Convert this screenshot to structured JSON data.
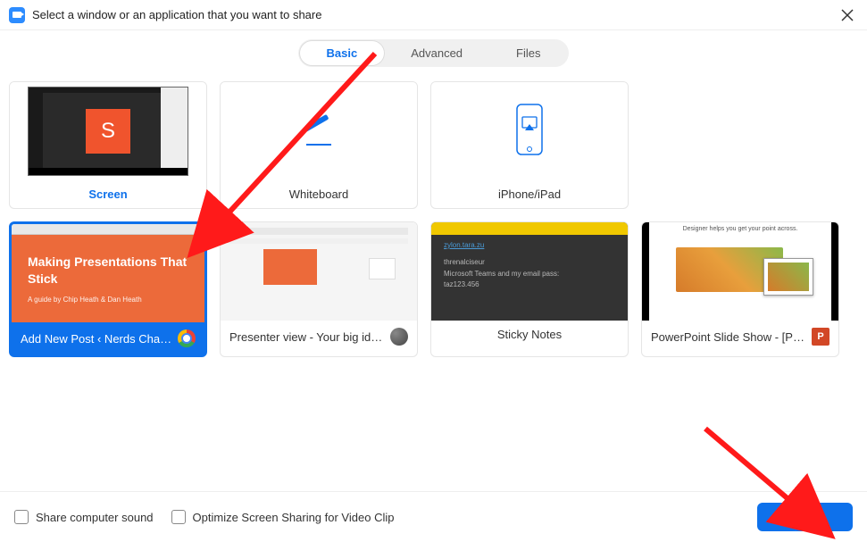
{
  "header": {
    "title": "Select a window or an application that you want to share"
  },
  "tabs": {
    "basic": "Basic",
    "advanced": "Advanced",
    "files": "Files",
    "active": "basic"
  },
  "tiles": {
    "screen": {
      "label": "Screen"
    },
    "whiteboard": {
      "label": "Whiteboard"
    },
    "iphone": {
      "label": "iPhone/iPad"
    },
    "chrome_window": {
      "label": "Add New Post ‹ Nerds Chalk — …",
      "slide_title": "Making Presentations That Stick",
      "slide_sub": "A guide by Chip Heath & Dan Heath"
    },
    "presenter": {
      "label": "Presenter view - Your big idea - G…"
    },
    "sticky": {
      "label": "Sticky Notes",
      "line1": "zylon.tara.zu",
      "line2": "threnalciseur",
      "line3": "Microsoft Teams and my email pass:",
      "line4": "taz123.456"
    },
    "ppt": {
      "label": "PowerPoint Slide Show - [Present…",
      "header_text": "Designer helps you get your point across."
    }
  },
  "footer": {
    "share_sound": "Share computer sound",
    "optimize_video": "Optimize Screen Sharing for Video Clip",
    "share_button": "Share"
  },
  "colors": {
    "accent": "#0e71eb",
    "orange": "#ec6a3a",
    "ppt_red": "#d24726"
  }
}
